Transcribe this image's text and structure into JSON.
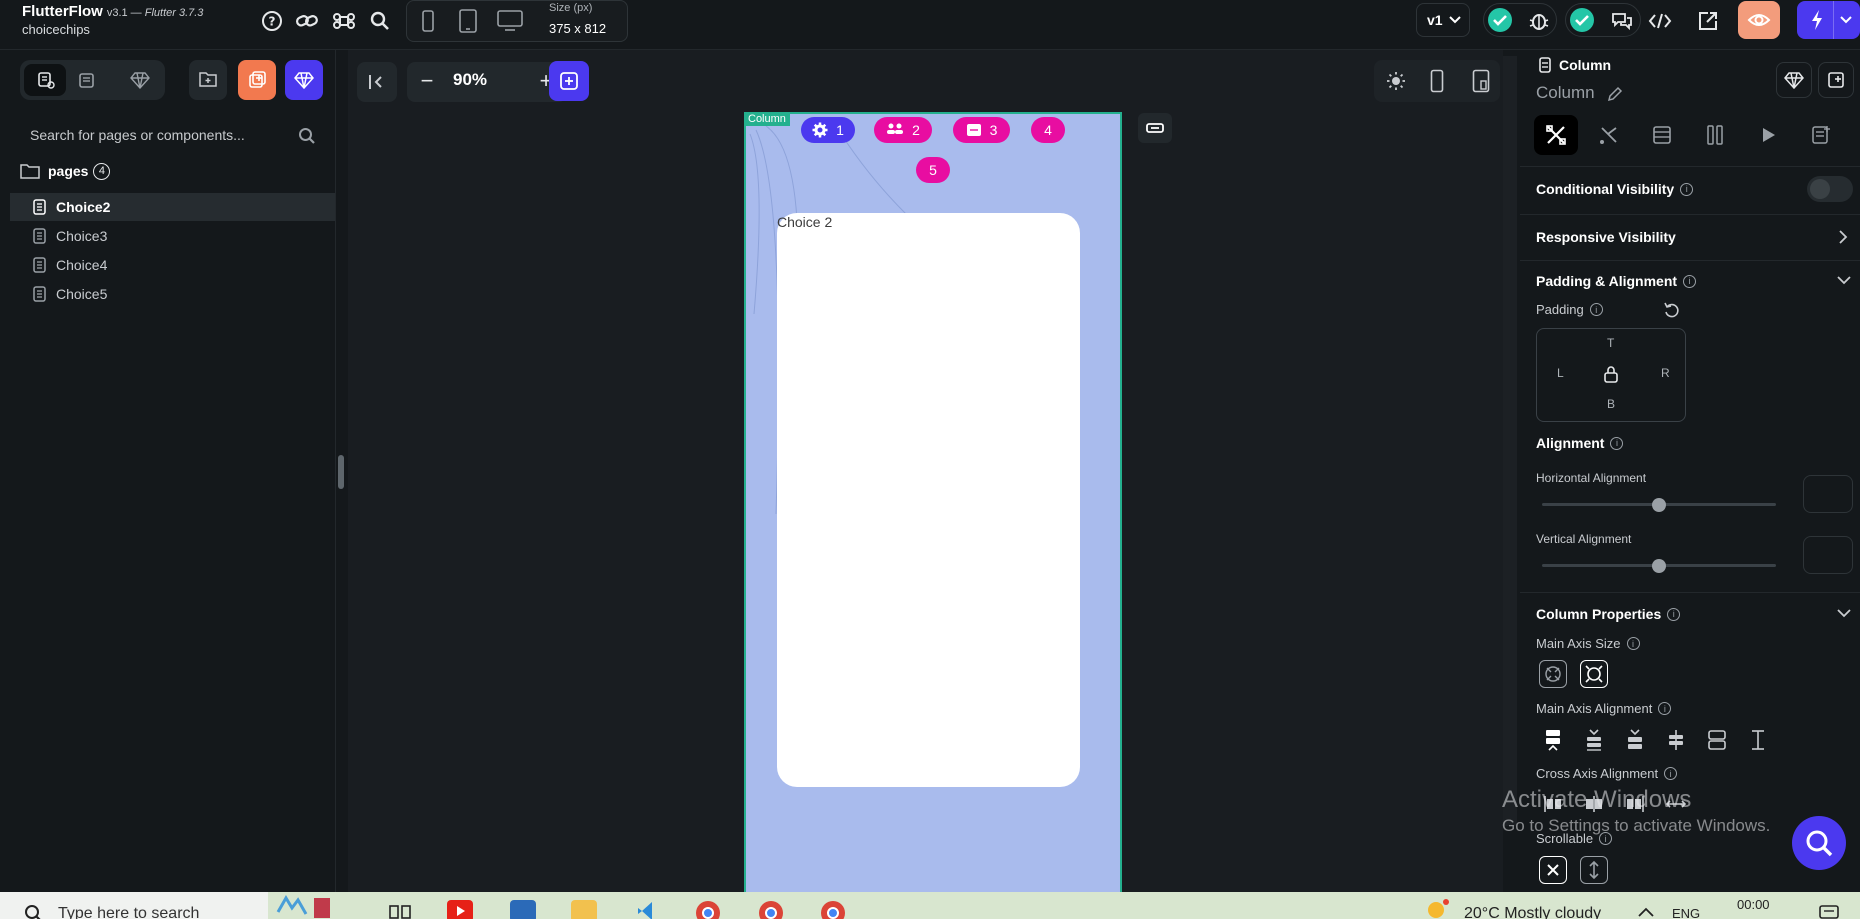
{
  "app": {
    "name": "FlutterFlow",
    "version_prefix": "v3.1 — ",
    "version_flutter": "Flutter 3.7.3",
    "project": "choicechips"
  },
  "toolbar": {
    "size_label": "Size (px)",
    "size_value": "375 x 812",
    "version": "v1"
  },
  "left_panel": {
    "search_placeholder": "Search for pages or components...",
    "pages_label": "pages",
    "pages_count": "4",
    "pages": [
      {
        "label": "Choice2",
        "active": true
      },
      {
        "label": "Choice3",
        "active": false
      },
      {
        "label": "Choice4",
        "active": false
      },
      {
        "label": "Choice5",
        "active": false
      }
    ]
  },
  "canvas": {
    "zoom_minus": "−",
    "zoom": "90%",
    "zoom_plus": "+",
    "selected_tag": "Column",
    "steps": [
      "1",
      "2",
      "3",
      "4",
      "5"
    ],
    "card_text": "Choice 2"
  },
  "right_panel": {
    "widget_type": "Column",
    "widget_name": "Column",
    "conditional_visibility": "Conditional Visibility",
    "responsive_visibility": "Responsive Visibility",
    "padding_alignment": "Padding & Alignment",
    "padding": "Padding",
    "padding_letters": {
      "t": "T",
      "l": "L",
      "r": "R",
      "b": "B"
    },
    "alignment": "Alignment",
    "horizontal_alignment": "Horizontal Alignment",
    "vertical_alignment": "Vertical Alignment",
    "column_properties": "Column Properties",
    "main_axis_size": "Main Axis Size",
    "main_axis_alignment": "Main Axis Alignment",
    "cross_axis_alignment": "Cross Axis Alignment",
    "scrollable": "Scrollable",
    "info": "i"
  },
  "watermark": {
    "line1": "Activate Windows",
    "line2": "Go to Settings to activate Windows."
  },
  "taskbar": {
    "search": "Type here to search",
    "weather": "20°C  Mostly cloudy",
    "lang": "ENG",
    "time": "00:00"
  },
  "colors": {
    "accent": "#4b39ef",
    "step_pink": "#e80da1",
    "selection_green": "#24b08e",
    "phone_bg": "#a9bbed",
    "check_green": "#24c6a7",
    "preview_orange": "#f39c7c"
  }
}
